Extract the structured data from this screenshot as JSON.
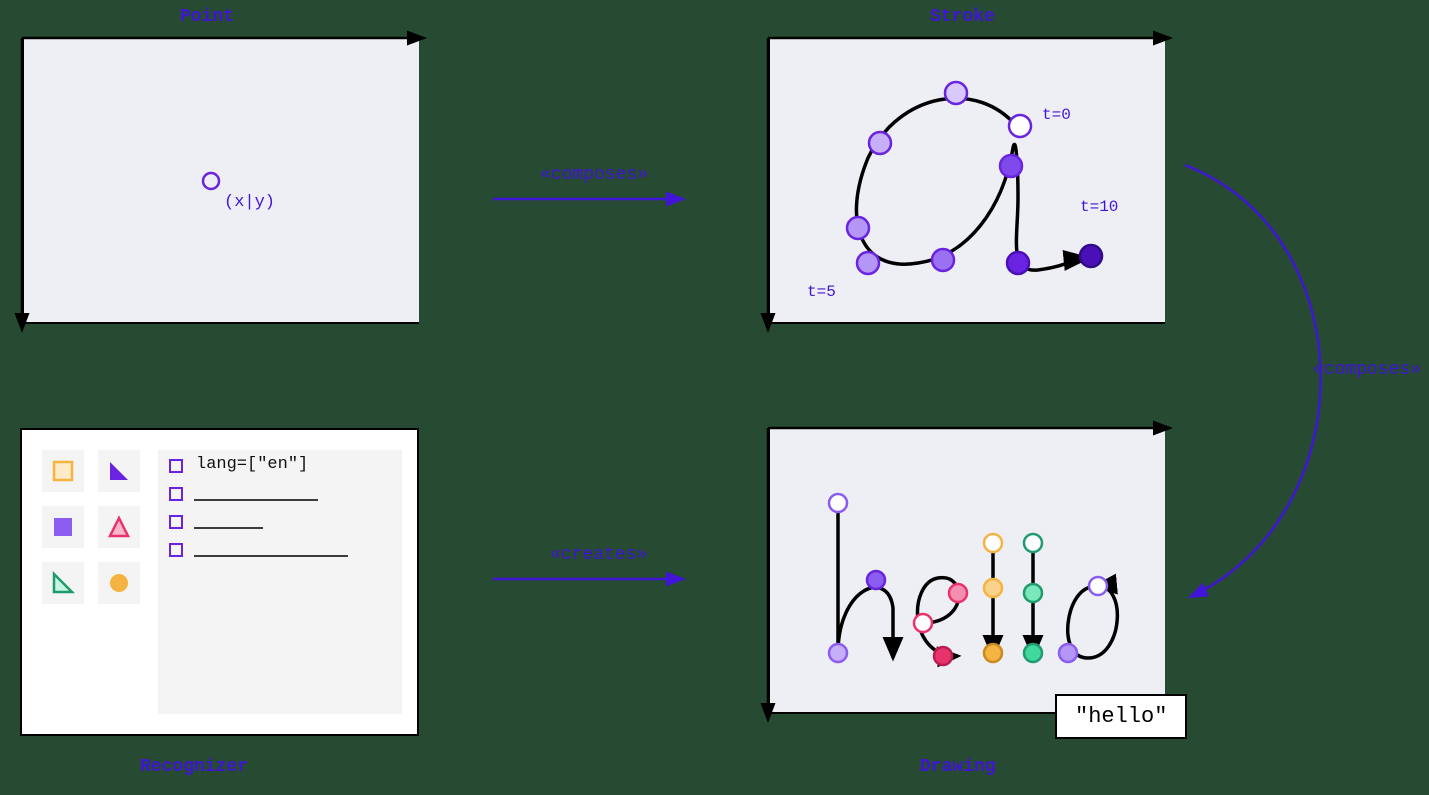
{
  "titles": {
    "point": "Point",
    "stroke": "Stroke",
    "recognizer": "Recognizer",
    "drawing": "Drawing"
  },
  "arrows": {
    "composes1": "«composes»",
    "composes2": "«composes»",
    "creates": "«creates»"
  },
  "point": {
    "coord": "(x|y)"
  },
  "stroke": {
    "t0": "t=0",
    "t5": "t=5",
    "t10": "t=10"
  },
  "recognizer": {
    "lang": "lang=[\"en\"]"
  },
  "drawing": {
    "result": "\"hello\""
  },
  "colors": {
    "accent": "#4015d8",
    "panel_bg": "#eeeef5",
    "orange": "#f5b342",
    "purple": "#8a5cf0",
    "pink": "#e8326b",
    "green": "#3fd99b",
    "violet": "#6a23e0"
  }
}
